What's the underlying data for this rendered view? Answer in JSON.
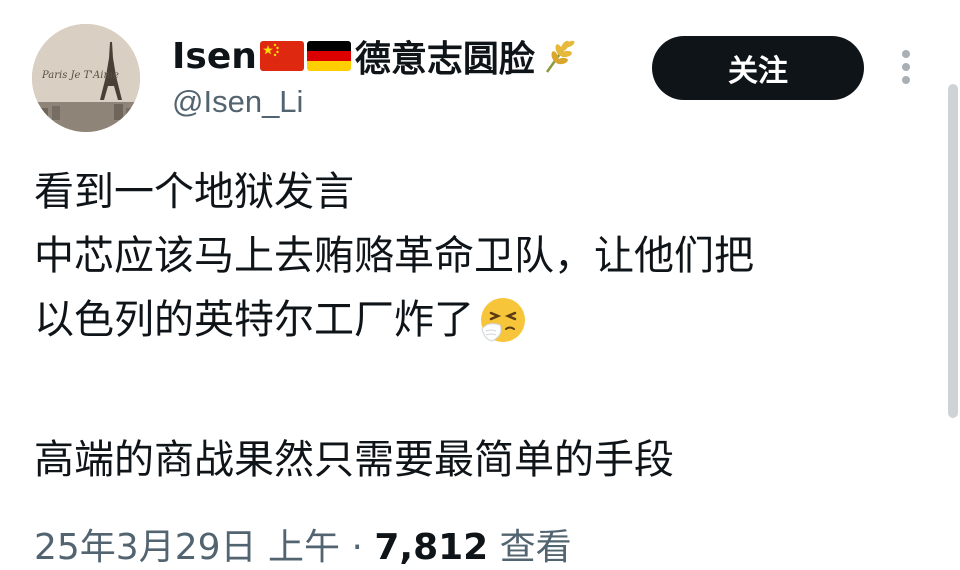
{
  "author": {
    "display_name": "Isen",
    "name_suffix": "德意志圆脸",
    "handle": "@Isen_Li",
    "avatar_caption": "Paris Je T'Aime",
    "flags": [
      "china-flag-icon",
      "germany-flag-icon"
    ],
    "badge_icon": "wheat-icon"
  },
  "actions": {
    "follow_label": "关注",
    "more_icon": "more-vertical-icon"
  },
  "tweet": {
    "lines": [
      "看到一个地狱发言",
      "中芯应该马上去贿赂革命卫队，让他们把",
      "以色列的英特尔工厂炸了",
      "高端的商战果然只需要最简单的手段"
    ],
    "emoji": "sneezing-face-icon"
  },
  "meta": {
    "date": "25年3月29日",
    "time": "上午",
    "views_count": "7,812",
    "views_label": "查看"
  },
  "colors": {
    "text_primary": "#0f1419",
    "text_secondary": "#536471",
    "button_bg": "#0f1419",
    "button_text": "#ffffff"
  }
}
